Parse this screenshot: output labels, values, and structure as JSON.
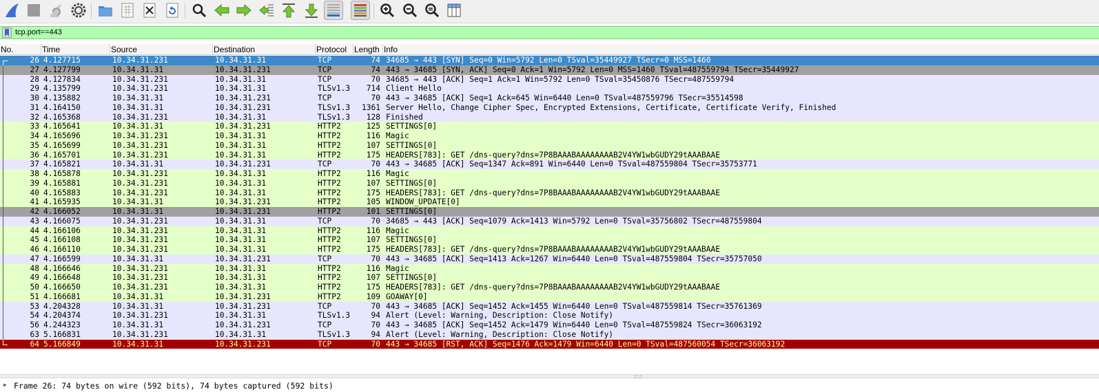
{
  "filter": {
    "value": "tcp.port==443"
  },
  "columns": [
    "No.",
    "Time",
    "Source",
    "Destination",
    "Protocol",
    "Length",
    "Info"
  ],
  "colors": {
    "selected_bg": "#3d89c9",
    "selected_fg": "#ffffff",
    "tcp_bg": "#e7e6ff",
    "tls_bg": "#e7e6ff",
    "http2_bg": "#e4ffc7",
    "gray_bg": "#a0a0a0",
    "rst_bg": "#a40000",
    "rst_fg": "#fffc9c",
    "filter_bg": "#afffaf"
  },
  "packets": [
    {
      "no": "26",
      "time": "4.127715",
      "src": "10.34.31.231",
      "dst": "10.34.31.31",
      "proto": "TCP",
      "len": "74",
      "info": "34685 → 443 [SYN] Seq=0 Win=5792 Len=0 TSval=35449927 TSecr=0 MSS=1460",
      "style": "selected"
    },
    {
      "no": "27",
      "time": "4.127799",
      "src": "10.34.31.31",
      "dst": "10.34.31.231",
      "proto": "TCP",
      "len": "74",
      "info": "443 → 34685 [SYN, ACK] Seq=0 Ack=1 Win=5792 Len=0 MSS=1460 TSval=487559794 TSecr=35449927",
      "style": "gray"
    },
    {
      "no": "28",
      "time": "4.127834",
      "src": "10.34.31.231",
      "dst": "10.34.31.31",
      "proto": "TCP",
      "len": "70",
      "info": "34685 → 443 [ACK] Seq=1 Ack=1 Win=5792 Len=0 TSval=35450876 TSecr=487559794",
      "style": "tcp"
    },
    {
      "no": "29",
      "time": "4.135799",
      "src": "10.34.31.231",
      "dst": "10.34.31.31",
      "proto": "TLSv1.3",
      "len": "714",
      "info": "Client Hello",
      "style": "tcp"
    },
    {
      "no": "30",
      "time": "4.135882",
      "src": "10.34.31.31",
      "dst": "10.34.31.231",
      "proto": "TCP",
      "len": "70",
      "info": "443 → 34685 [ACK] Seq=1 Ack=645 Win=6440 Len=0 TSval=487559796 TSecr=35514598",
      "style": "tcp"
    },
    {
      "no": "31",
      "time": "4.164150",
      "src": "10.34.31.31",
      "dst": "10.34.31.231",
      "proto": "TLSv1.3",
      "len": "1361",
      "info": "Server Hello, Change Cipher Spec, Encrypted Extensions, Certificate, Certificate Verify, Finished",
      "style": "tcp"
    },
    {
      "no": "32",
      "time": "4.165368",
      "src": "10.34.31.231",
      "dst": "10.34.31.31",
      "proto": "TLSv1.3",
      "len": "128",
      "info": "Finished",
      "style": "tcp"
    },
    {
      "no": "33",
      "time": "4.165641",
      "src": "10.34.31.31",
      "dst": "10.34.31.231",
      "proto": "HTTP2",
      "len": "125",
      "info": "SETTINGS[0]",
      "style": "http2"
    },
    {
      "no": "34",
      "time": "4.165696",
      "src": "10.34.31.231",
      "dst": "10.34.31.31",
      "proto": "HTTP2",
      "len": "116",
      "info": "Magic",
      "style": "http2"
    },
    {
      "no": "35",
      "time": "4.165699",
      "src": "10.34.31.231",
      "dst": "10.34.31.31",
      "proto": "HTTP2",
      "len": "107",
      "info": "SETTINGS[0]",
      "style": "http2"
    },
    {
      "no": "36",
      "time": "4.165701",
      "src": "10.34.31.231",
      "dst": "10.34.31.31",
      "proto": "HTTP2",
      "len": "175",
      "info": "HEADERS[783]: GET /dns-query?dns=7P8BAAABAAAAAAAAB2V4YW1wbGUDY29tAAABAAE",
      "style": "http2"
    },
    {
      "no": "37",
      "time": "4.165821",
      "src": "10.34.31.31",
      "dst": "10.34.31.231",
      "proto": "TCP",
      "len": "70",
      "info": "443 → 34685 [ACK] Seq=1347 Ack=891 Win=6440 Len=0 TSval=487559804 TSecr=35753771",
      "style": "tcp"
    },
    {
      "no": "38",
      "time": "4.165878",
      "src": "10.34.31.231",
      "dst": "10.34.31.31",
      "proto": "HTTP2",
      "len": "116",
      "info": "Magic",
      "style": "http2"
    },
    {
      "no": "39",
      "time": "4.165881",
      "src": "10.34.31.231",
      "dst": "10.34.31.31",
      "proto": "HTTP2",
      "len": "107",
      "info": "SETTINGS[0]",
      "style": "http2"
    },
    {
      "no": "40",
      "time": "4.165883",
      "src": "10.34.31.231",
      "dst": "10.34.31.31",
      "proto": "HTTP2",
      "len": "175",
      "info": "HEADERS[783]: GET /dns-query?dns=7P8BAAABAAAAAAAAB2V4YW1wbGUDY29tAAABAAE",
      "style": "http2"
    },
    {
      "no": "41",
      "time": "4.165935",
      "src": "10.34.31.31",
      "dst": "10.34.31.231",
      "proto": "HTTP2",
      "len": "105",
      "info": "WINDOW_UPDATE[0]",
      "style": "http2"
    },
    {
      "no": "42",
      "time": "4.166052",
      "src": "10.34.31.31",
      "dst": "10.34.31.231",
      "proto": "HTTP2",
      "len": "101",
      "info": "SETTINGS[0]",
      "style": "gray"
    },
    {
      "no": "43",
      "time": "4.166075",
      "src": "10.34.31.231",
      "dst": "10.34.31.31",
      "proto": "TCP",
      "len": "70",
      "info": "34685 → 443 [ACK] Seq=1079 Ack=1413 Win=5792 Len=0 TSval=35756802 TSecr=487559804",
      "style": "tcp"
    },
    {
      "no": "44",
      "time": "4.166106",
      "src": "10.34.31.231",
      "dst": "10.34.31.31",
      "proto": "HTTP2",
      "len": "116",
      "info": "Magic",
      "style": "http2"
    },
    {
      "no": "45",
      "time": "4.166108",
      "src": "10.34.31.231",
      "dst": "10.34.31.31",
      "proto": "HTTP2",
      "len": "107",
      "info": "SETTINGS[0]",
      "style": "http2"
    },
    {
      "no": "46",
      "time": "4.166110",
      "src": "10.34.31.231",
      "dst": "10.34.31.31",
      "proto": "HTTP2",
      "len": "175",
      "info": "HEADERS[783]: GET /dns-query?dns=7P8BAAABAAAAAAAAB2V4YW1wbGUDY29tAAABAAE",
      "style": "http2"
    },
    {
      "no": "47",
      "time": "4.166599",
      "src": "10.34.31.31",
      "dst": "10.34.31.231",
      "proto": "TCP",
      "len": "70",
      "info": "443 → 34685 [ACK] Seq=1413 Ack=1267 Win=6440 Len=0 TSval=487559804 TSecr=35757050",
      "style": "tcp"
    },
    {
      "no": "48",
      "time": "4.166646",
      "src": "10.34.31.231",
      "dst": "10.34.31.31",
      "proto": "HTTP2",
      "len": "116",
      "info": "Magic",
      "style": "http2"
    },
    {
      "no": "49",
      "time": "4.166648",
      "src": "10.34.31.231",
      "dst": "10.34.31.31",
      "proto": "HTTP2",
      "len": "107",
      "info": "SETTINGS[0]",
      "style": "http2"
    },
    {
      "no": "50",
      "time": "4.166650",
      "src": "10.34.31.231",
      "dst": "10.34.31.31",
      "proto": "HTTP2",
      "len": "175",
      "info": "HEADERS[783]: GET /dns-query?dns=7P8BAAABAAAAAAAAB2V4YW1wbGUDY29tAAABAAE",
      "style": "http2"
    },
    {
      "no": "51",
      "time": "4.166681",
      "src": "10.34.31.31",
      "dst": "10.34.31.231",
      "proto": "HTTP2",
      "len": "109",
      "info": "GOAWAY[0]",
      "style": "http2"
    },
    {
      "no": "53",
      "time": "4.204328",
      "src": "10.34.31.31",
      "dst": "10.34.31.231",
      "proto": "TCP",
      "len": "70",
      "info": "443 → 34685 [ACK] Seq=1452 Ack=1455 Win=6440 Len=0 TSval=487559814 TSecr=35761369",
      "style": "tcp"
    },
    {
      "no": "54",
      "time": "4.204374",
      "src": "10.34.31.231",
      "dst": "10.34.31.31",
      "proto": "TLSv1.3",
      "len": "94",
      "info": "Alert (Level: Warning, Description: Close Notify)",
      "style": "tcp"
    },
    {
      "no": "56",
      "time": "4.244323",
      "src": "10.34.31.31",
      "dst": "10.34.31.231",
      "proto": "TCP",
      "len": "70",
      "info": "443 → 34685 [ACK] Seq=1452 Ack=1479 Win=6440 Len=0 TSval=487559824 TSecr=36063192",
      "style": "tcp"
    },
    {
      "no": "63",
      "time": "5.166831",
      "src": "10.34.31.231",
      "dst": "10.34.31.31",
      "proto": "TLSv1.3",
      "len": "94",
      "info": "Alert (Level: Warning, Description: Close Notify)",
      "style": "tcp"
    },
    {
      "no": "64",
      "time": "5.166849",
      "src": "10.34.31.31",
      "dst": "10.34.31.231",
      "proto": "TCP",
      "len": "70",
      "info": "443 → 34685 [RST, ACK] Seq=1476 Ack=1479 Win=6440 Len=0 TSval=487560054 TSecr=36063192",
      "style": "rst"
    }
  ],
  "details": {
    "frame_summary": "Frame 26: 74 bytes on wire (592 bits), 74 bytes captured (592 bits)"
  }
}
